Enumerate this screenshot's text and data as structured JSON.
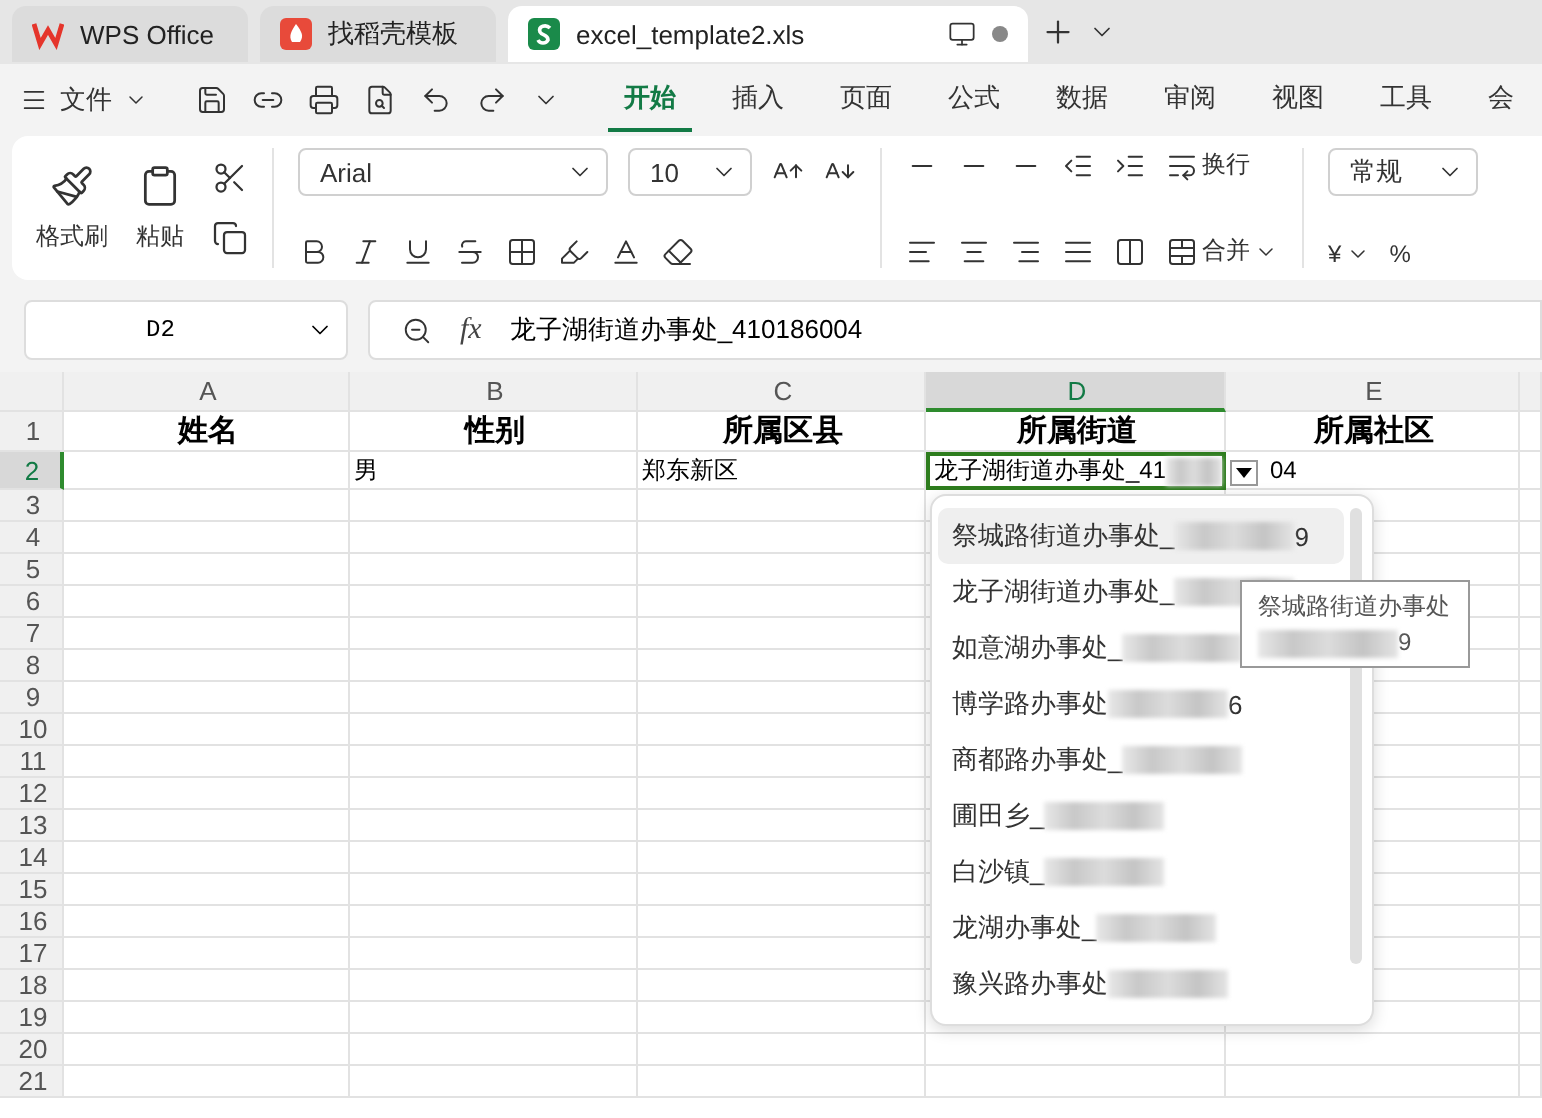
{
  "tabs": [
    {
      "label": "WPS Office",
      "kind": "wps",
      "selected": false
    },
    {
      "label": "找稻壳模板",
      "kind": "docer",
      "selected": false
    },
    {
      "label": "excel_template2.xls",
      "kind": "sheet",
      "selected": true
    }
  ],
  "menu": {
    "file": "文件",
    "tabs": [
      {
        "label": "开始",
        "selected": true
      },
      {
        "label": "插入",
        "selected": false
      },
      {
        "label": "页面",
        "selected": false
      },
      {
        "label": "公式",
        "selected": false
      },
      {
        "label": "数据",
        "selected": false
      },
      {
        "label": "审阅",
        "selected": false
      },
      {
        "label": "视图",
        "selected": false
      },
      {
        "label": "工具",
        "selected": false
      },
      {
        "label": "会",
        "selected": false
      }
    ]
  },
  "ribbon": {
    "format_painter": "格式刷",
    "paste": "粘贴",
    "font": "Arial",
    "size": "10",
    "wrap": "换行",
    "merge": "合并",
    "number_format": "常规",
    "currency": "¥",
    "percent": "%"
  },
  "name_box": "D2",
  "fx": "fx",
  "formula": "龙子湖街道办事处_410186004",
  "columns": [
    {
      "label": "A",
      "selected": false
    },
    {
      "label": "B",
      "selected": false
    },
    {
      "label": "C",
      "selected": false
    },
    {
      "label": "D",
      "selected": true
    },
    {
      "label": "E",
      "selected": false
    }
  ],
  "rows": [
    {
      "label": "1",
      "selected": false,
      "kind": "header",
      "cells": [
        "姓名",
        "性别",
        "所属区县",
        "所属街道",
        "所属社区"
      ]
    },
    {
      "label": "2",
      "selected": true,
      "kind": "data",
      "cells": [
        null,
        "男",
        "郑东新区",
        "龙子湖街道办事处_41",
        "04"
      ]
    },
    {
      "label": "3",
      "selected": false
    },
    {
      "label": "4",
      "selected": false
    },
    {
      "label": "5",
      "selected": false
    },
    {
      "label": "6",
      "selected": false
    },
    {
      "label": "7",
      "selected": false
    },
    {
      "label": "8",
      "selected": false
    },
    {
      "label": "9",
      "selected": false
    },
    {
      "label": "10",
      "selected": false
    },
    {
      "label": "11",
      "selected": false
    },
    {
      "label": "12",
      "selected": false
    },
    {
      "label": "13",
      "selected": false
    },
    {
      "label": "14",
      "selected": false
    },
    {
      "label": "15",
      "selected": false
    },
    {
      "label": "16",
      "selected": false
    },
    {
      "label": "17",
      "selected": false
    },
    {
      "label": "18",
      "selected": false
    },
    {
      "label": "19",
      "selected": false
    },
    {
      "label": "20",
      "selected": false
    },
    {
      "label": "21",
      "selected": false
    }
  ],
  "dropdown": {
    "options": [
      {
        "label": "祭城路街道办事处_",
        "suffix": "9",
        "selected": true
      },
      {
        "label": "龙子湖街道办事处_",
        "selected": false
      },
      {
        "label": "如意湖办事处_",
        "selected": false
      },
      {
        "label": "博学路办事处",
        "suffix": "6",
        "selected": false
      },
      {
        "label": "商都路办事处_",
        "selected": false
      },
      {
        "label": "圃田乡_",
        "selected": false
      },
      {
        "label": "白沙镇_",
        "selected": false
      },
      {
        "label": "龙湖办事处_",
        "selected": false
      },
      {
        "label": "豫兴路办事处",
        "selected": false
      }
    ]
  },
  "tooltip": {
    "lines": [
      "祭城路街道办事处",
      "9"
    ]
  }
}
